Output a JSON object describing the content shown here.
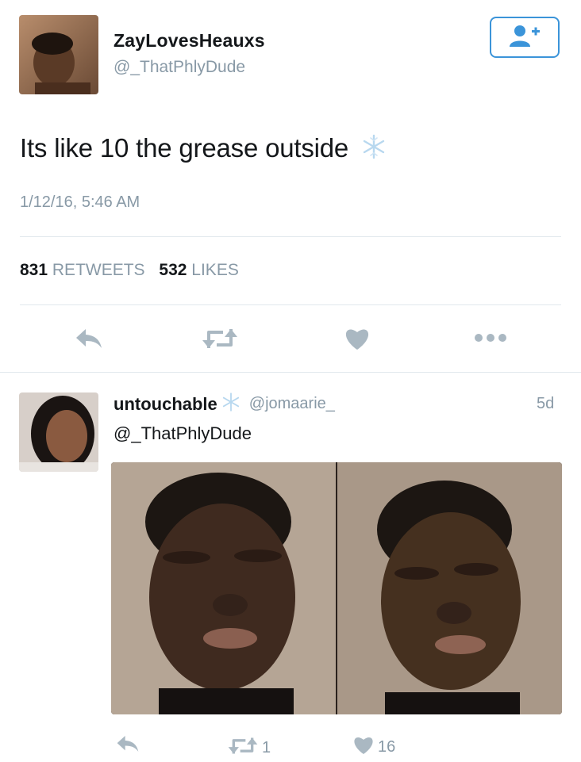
{
  "tweet": {
    "user_name": "ZayLovesHeauxs",
    "user_handle": "@_ThatPhlyDude",
    "text": "Its like 10 the grease outside",
    "timestamp": "1/12/16, 5:46 AM",
    "retweet_count": "831",
    "retweet_label": "RETWEETS",
    "like_count": "532",
    "like_label": "LIKES"
  },
  "reply": {
    "user_name": "untouchable",
    "user_handle": "@jomaarie_",
    "time": "5d",
    "text": "@_ThatPhlyDude",
    "retweet_count": "1",
    "like_count": "16"
  },
  "icons": {
    "follow": "add-user-icon",
    "reply": "reply-arrow-icon",
    "retweet": "retweet-icon",
    "like": "heart-icon",
    "more": "more-dots-icon",
    "emoji": "snowflake-emoji-icon"
  },
  "colors": {
    "accent": "#3b94d9",
    "muted": "#8899a6",
    "text": "#14171a",
    "divider": "#e1e8ed",
    "icon_gray": "#aab8c2"
  }
}
